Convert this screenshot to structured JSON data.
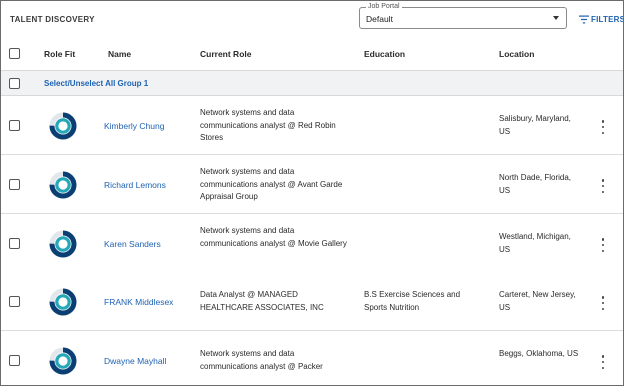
{
  "app": {
    "title": "TALENT DISCOVERY"
  },
  "job_portal": {
    "legend": "Job Portal",
    "value": "Default"
  },
  "filters": {
    "label": "FILTERS"
  },
  "columns": {
    "role_fit": "Role Fit",
    "name": "Name",
    "current_role": "Current Role",
    "education": "Education",
    "location": "Location"
  },
  "group": {
    "label": "Select/Unselect All Group 1"
  },
  "colors": {
    "link": "#1e62b3",
    "fit_dark": "#0b3f73",
    "fit_teal": "#27a8b8"
  },
  "rows": [
    {
      "name": "Kimberly Chung",
      "role": "Network systems and data communications analyst @ Red Robin Stores",
      "education": "",
      "location": "Salisbury, Maryland, US",
      "fit": 0.75
    },
    {
      "name": "Richard Lemons",
      "role": "Network systems and data communications analyst @ Avant Garde Appraisal Group",
      "education": "",
      "location": "North Dade, Florida, US",
      "fit": 0.75
    },
    {
      "name": "Karen Sanders",
      "role": "Network systems and data communications analyst @ Movie Gallery",
      "education": "",
      "location": "Westland, Michigan, US",
      "fit": 0.75
    },
    {
      "name": "FRANK Middlesex",
      "role": "Data Analyst @ MANAGED HEALTHCARE ASSOCIATES, INC",
      "education": "B.S Exercise Sciences and Sports Nutrition",
      "location": "Carteret, New Jersey, US",
      "fit": 0.75
    },
    {
      "name": "Dwayne Mayhall",
      "role": "Network systems and data communications analyst @ Packer",
      "education": "",
      "location": "Beggs, Oklahoma, US",
      "fit": 0.75
    }
  ]
}
